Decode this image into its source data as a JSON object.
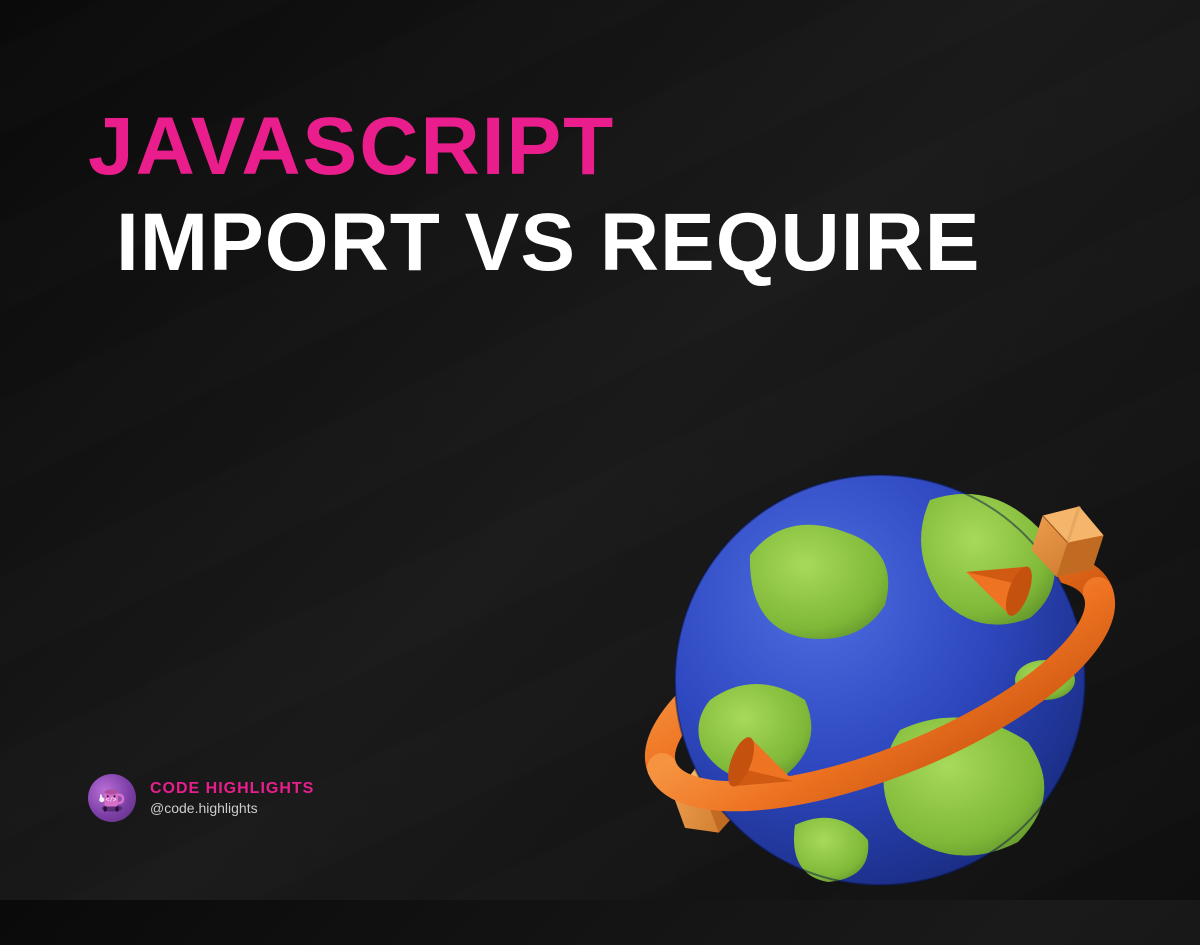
{
  "title": {
    "line1": "JAVASCRIPT",
    "line2": "IMPORT VS REQUIRE"
  },
  "attribution": {
    "name": "CODE HIGHLIGHTS",
    "handle": "@code.highlights"
  },
  "colors": {
    "accent": "#e91e8c",
    "text": "#ffffff",
    "bg": "#0f0f0f",
    "globe_blue": "#2846c8",
    "globe_green": "#88c43a",
    "ring_orange": "#ee7322",
    "box_orange": "#e68a2e"
  },
  "icons": {
    "avatar": "mug-mascot-icon",
    "globe": "globe-packages-icon"
  }
}
